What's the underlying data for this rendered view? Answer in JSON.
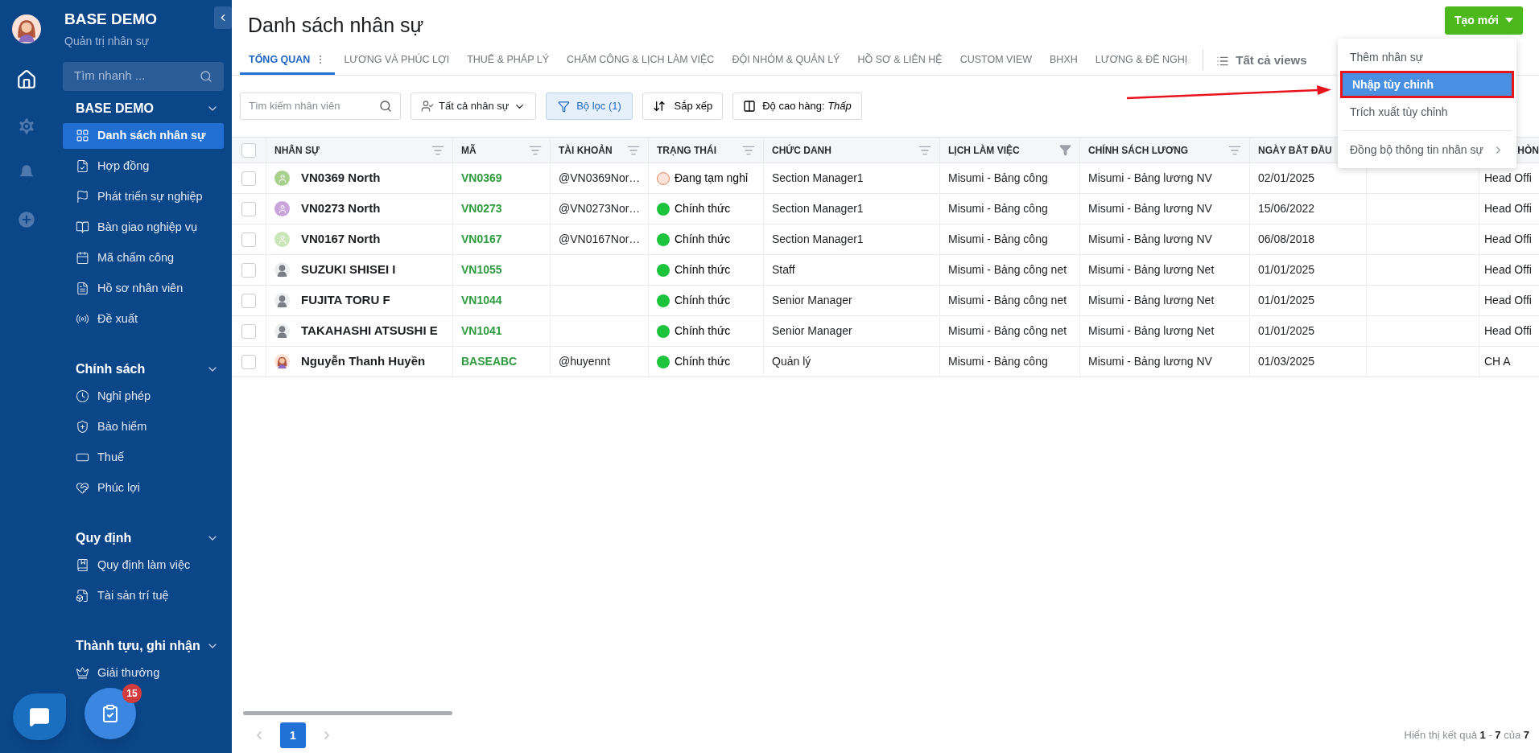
{
  "rail": {
    "items": [
      {
        "selected": true
      },
      {
        "selected": false
      },
      {
        "selected": false
      },
      {
        "selected": false
      }
    ]
  },
  "sidebar": {
    "title": "BASE DEMO",
    "subtitle": "Quản trị nhân sự",
    "search": {
      "placeholder": "Tìm nhanh ..."
    },
    "sections": [
      {
        "title": "BASE DEMO",
        "expanded": true,
        "items": [
          {
            "label": "Danh sách nhân sự",
            "selected": true
          },
          {
            "label": "Hợp đồng",
            "selected": false
          },
          {
            "label": "Phát triển sự nghiệp",
            "selected": false
          },
          {
            "label": "Bàn giao nghiệp vụ",
            "selected": false
          },
          {
            "label": "Mã chấm công",
            "selected": false
          },
          {
            "label": "Hồ sơ nhân viên",
            "selected": false
          },
          {
            "label": "Đề xuất",
            "selected": false
          }
        ]
      },
      {
        "title": "Chính sách",
        "expanded": true,
        "items": [
          {
            "label": "Nghỉ phép",
            "selected": false
          },
          {
            "label": "Bảo hiểm",
            "selected": false
          },
          {
            "label": "Thuế",
            "selected": false
          },
          {
            "label": "Phúc lợi",
            "selected": false
          }
        ]
      },
      {
        "title": "Quy định",
        "expanded": true,
        "items": [
          {
            "label": "Quy định làm việc",
            "selected": false
          },
          {
            "label": "Tài sản trí tuệ",
            "selected": false
          }
        ]
      },
      {
        "title": "Thành tựu, ghi nhận",
        "expanded": true,
        "items": [
          {
            "label": "Giải thưởng",
            "selected": false
          }
        ]
      }
    ]
  },
  "floating": {
    "task_badge": "15"
  },
  "page": {
    "title": "Danh sách nhân sự",
    "create_button": "Tạo mới"
  },
  "tabs": [
    {
      "label": "TỔNG QUAN",
      "selected": true
    },
    {
      "label": "LƯƠNG VÀ PHÚC LỢI",
      "selected": false
    },
    {
      "label": "THUẾ & PHÁP LÝ",
      "selected": false
    },
    {
      "label": "CHẤM CÔNG & LỊCH LÀM VIỆC",
      "selected": false
    },
    {
      "label": "ĐỘI NHÓM & QUẢN LÝ",
      "selected": false
    },
    {
      "label": "HỒ SƠ & LIÊN HỆ",
      "selected": false
    },
    {
      "label": "CUSTOM VIEW",
      "selected": false
    },
    {
      "label": "BHXH",
      "selected": false
    },
    {
      "label": "LƯƠNG & ĐỀ NGHỊ",
      "selected": false
    }
  ],
  "all_views": "Tất cả views",
  "toolbar": {
    "search": {
      "placeholder": "Tìm kiếm nhân viên"
    },
    "scope": "Tất cả nhân sự",
    "filter": "Bộ lọc (1)",
    "filter_active": true,
    "sort": "Sắp xếp",
    "row_height": "Độ cao hàng: *Thấp*"
  },
  "menu": {
    "items": [
      {
        "label": "Thêm nhân sự",
        "selected": false,
        "outlined": false,
        "kind": "action"
      },
      {
        "label": "Nhập tùy chỉnh",
        "selected": true,
        "outlined": true,
        "kind": "action"
      },
      {
        "label": "Trích xuất tùy chỉnh",
        "selected": false,
        "outlined": false,
        "kind": "action"
      },
      {
        "label": "Đồng bộ thông tin nhân sự",
        "selected": false,
        "outlined": false,
        "kind": "submenu"
      }
    ]
  },
  "table": {
    "select_all_checked": false,
    "columns": [
      {
        "label": "NHÂN SỰ",
        "filtered": false
      },
      {
        "label": "MÃ",
        "filtered": false
      },
      {
        "label": "TÀI KHOẢN",
        "filtered": false
      },
      {
        "label": "TRẠNG THÁI",
        "filtered": false
      },
      {
        "label": "CHỨC DANH",
        "filtered": false
      },
      {
        "label": "LỊCH LÀM VIỆC",
        "filtered": true
      },
      {
        "label": "CHÍNH SÁCH LƯƠNG",
        "filtered": false
      },
      {
        "label": "NGÀY BẮT ĐẦU"
      },
      {},
      {
        "label": "HÒN"
      }
    ],
    "rows": [
      {
        "checked": false,
        "avatar": {
          "kind": "user",
          "color": "#a9d18e"
        },
        "name": "VN0369 North",
        "code": "VN0369",
        "account": "@VN0369Nor…",
        "status": {
          "kind": "leave",
          "label": "Đang tạm nghỉ"
        },
        "title": "Section Manager1",
        "schedule": "Misumi - Bảng công",
        "policy": "Misumi - Bảng lương NV",
        "start": "02/01/2025",
        "column_10": "Head Offi"
      },
      {
        "checked": false,
        "avatar": {
          "kind": "user",
          "color": "#c9a5dc"
        },
        "name": "VN0273 North",
        "code": "VN0273",
        "account": "@VN0273Nor…",
        "status": {
          "kind": "official",
          "label": "Chính thức"
        },
        "title": "Section Manager1",
        "schedule": "Misumi - Bảng công",
        "policy": "Misumi - Bảng lương NV",
        "start": "15/06/2022",
        "column_10": "Head Offi"
      },
      {
        "checked": false,
        "avatar": {
          "kind": "user",
          "color": "#cbe6b8"
        },
        "name": "VN0167 North",
        "code": "VN0167",
        "account": "@VN0167Nor…",
        "status": {
          "kind": "official",
          "label": "Chính thức"
        },
        "title": "Section Manager1",
        "schedule": "Misumi - Bảng công",
        "policy": "Misumi - Bảng lương NV",
        "start": "06/08/2018",
        "column_10": "Head Offi"
      },
      {
        "checked": false,
        "avatar": {
          "kind": "silhouette"
        },
        "name": "SUZUKI SHISEI I",
        "code": "VN1055",
        "status": {
          "kind": "official",
          "label": "Chính thức"
        },
        "title": "Staff",
        "schedule": "Misumi - Bảng công net",
        "policy": "Misumi - Bảng lương Net",
        "start": "01/01/2025",
        "column_10": "Head Offi"
      },
      {
        "checked": false,
        "avatar": {
          "kind": "silhouette"
        },
        "name": "FUJITA TORU F",
        "code": "VN1044",
        "status": {
          "kind": "official",
          "label": "Chính thức"
        },
        "title": "Senior Manager",
        "schedule": "Misumi - Bảng công net",
        "policy": "Misumi - Bảng lương Net",
        "start": "01/01/2025",
        "column_10": "Head Offi"
      },
      {
        "checked": false,
        "avatar": {
          "kind": "silhouette"
        },
        "name": "TAKAHASHI ATSUSHI E",
        "code": "VN1041",
        "status": {
          "kind": "official",
          "label": "Chính thức"
        },
        "title": "Senior Manager",
        "schedule": "Misumi - Bảng công net",
        "policy": "Misumi - Bảng lương Net",
        "start": "01/01/2025",
        "column_10": "Head Offi"
      },
      {
        "checked": false,
        "avatar": {
          "kind": "portrait"
        },
        "name": "Nguyễn Thanh Huyền",
        "code": "BASEABC",
        "account": "@huyennt",
        "status": {
          "kind": "official",
          "label": "Chính thức"
        },
        "title": "Quản lý",
        "schedule": "Misumi - Bảng công",
        "policy": "Misumi - Bảng lương NV",
        "start": "01/03/2025",
        "column_10": "CH A"
      }
    ]
  },
  "pagination": {
    "pages": [
      {
        "label": "1",
        "selected": true
      }
    ],
    "summary": "Hiển thị kết quả **1** - **7** của **7**"
  }
}
